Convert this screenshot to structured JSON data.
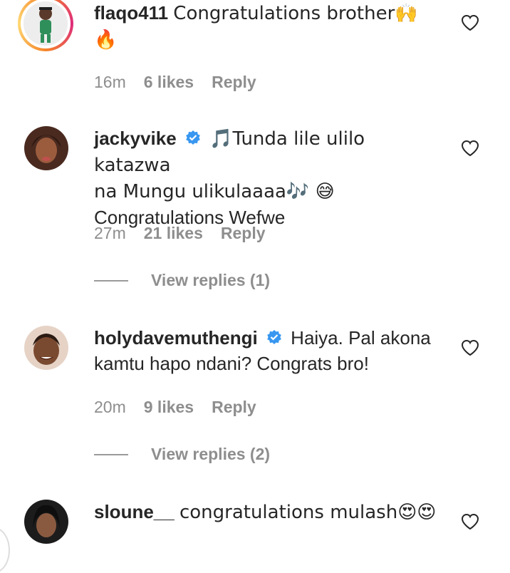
{
  "comments": [
    {
      "username": "flaqo411",
      "verified": false,
      "text": "Congratulations brother🙌",
      "text_line2": "🔥",
      "time": "16m",
      "likes": "6 likes",
      "reply": "Reply"
    },
    {
      "username": "jackyvike",
      "verified": true,
      "text": "🎵Tunda lile ulilo katazwa",
      "text_line2": "na Mungu ulikulaaaa🎶 😅",
      "text_line3": "Congratulations Wefwe",
      "time": "27m",
      "likes": "21 likes",
      "reply": "Reply",
      "view_replies": "View replies (1)"
    },
    {
      "username": "holydavemuthengi",
      "verified": true,
      "text": "Haiya. Pal akona",
      "text_line2": "kamtu hapo ndani? Congrats bro!",
      "time": "20m",
      "likes": "9 likes",
      "reply": "Reply",
      "view_replies": "View replies (2)"
    },
    {
      "username": "sloune__",
      "verified": false,
      "text": "congratulations mulash😍😍"
    }
  ],
  "icons": {
    "heart": "heart-outline-icon",
    "verified": "verified-badge-icon"
  },
  "colors": {
    "verified_blue": "#3897f0",
    "muted_text": "#8e8e8e",
    "story_ring": "#dd2a7b"
  }
}
